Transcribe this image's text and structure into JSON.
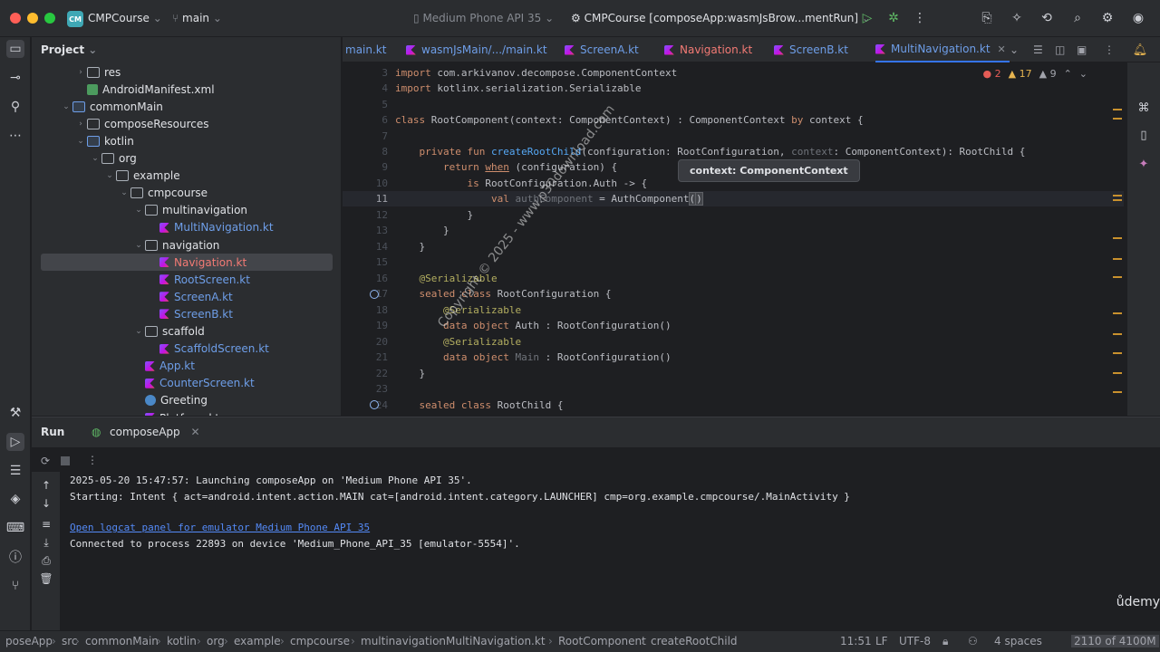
{
  "titlebar": {
    "project_badge": "CM",
    "project_name": "CMPCourse",
    "branch": "main",
    "device": "Medium Phone API 35",
    "run_config": "CMPCourse [composeApp:wasmJsBrow...mentRun]"
  },
  "project_panel": {
    "title": "Project",
    "tree": [
      {
        "label": "res",
        "depth": 4,
        "kind": "folder",
        "expanded": false
      },
      {
        "label": "AndroidManifest.xml",
        "depth": 4,
        "kind": "xml"
      },
      {
        "label": "commonMain",
        "depth": 3,
        "kind": "folder-blue",
        "expanded": true
      },
      {
        "label": "composeResources",
        "depth": 4,
        "kind": "folder",
        "expanded": false
      },
      {
        "label": "kotlin",
        "depth": 4,
        "kind": "folder-blue",
        "expanded": true
      },
      {
        "label": "org",
        "depth": 5,
        "kind": "folder",
        "expanded": true
      },
      {
        "label": "example",
        "depth": 6,
        "kind": "folder",
        "expanded": true
      },
      {
        "label": "cmpcourse",
        "depth": 7,
        "kind": "folder",
        "expanded": true
      },
      {
        "label": "multinavigation",
        "depth": 8,
        "kind": "folder",
        "expanded": true
      },
      {
        "label": "MultiNavigation.kt",
        "depth": 9,
        "kind": "kt",
        "color": "blue"
      },
      {
        "label": "navigation",
        "depth": 8,
        "kind": "folder",
        "expanded": true
      },
      {
        "label": "Navigation.kt",
        "depth": 9,
        "kind": "kt",
        "color": "red",
        "selected": true
      },
      {
        "label": "RootScreen.kt",
        "depth": 9,
        "kind": "kt",
        "color": "blue"
      },
      {
        "label": "ScreenA.kt",
        "depth": 9,
        "kind": "kt",
        "color": "blue"
      },
      {
        "label": "ScreenB.kt",
        "depth": 9,
        "kind": "kt",
        "color": "blue"
      },
      {
        "label": "scaffold",
        "depth": 8,
        "kind": "folder",
        "expanded": true
      },
      {
        "label": "ScaffoldScreen.kt",
        "depth": 9,
        "kind": "kt",
        "color": "blue"
      },
      {
        "label": "App.kt",
        "depth": 8,
        "kind": "kt",
        "color": "blue"
      },
      {
        "label": "CounterScreen.kt",
        "depth": 8,
        "kind": "kt",
        "color": "blue"
      },
      {
        "label": "Greeting",
        "depth": 8,
        "kind": "greeting"
      },
      {
        "label": "Platform.kt",
        "depth": 8,
        "kind": "kt"
      }
    ]
  },
  "tabs": [
    {
      "label": "main.kt"
    },
    {
      "label": "wasmJsMain/.../main.kt"
    },
    {
      "label": "ScreenA.kt"
    },
    {
      "label": "Navigation.kt"
    },
    {
      "label": "ScreenB.kt"
    },
    {
      "label": "MultiNavigation.kt",
      "active": true
    }
  ],
  "inspections": {
    "errors": "2",
    "warnings": "17",
    "weak": "9"
  },
  "editor": {
    "line_numbers": [
      "3",
      "4",
      "5",
      "6",
      "7",
      "8",
      "9",
      "10",
      "11",
      "12",
      "13",
      "14",
      "15",
      "16",
      "17",
      "18",
      "19",
      "20",
      "21",
      "22",
      "23",
      "24"
    ],
    "current_line": "11",
    "tooltip": "context: ComponentContext"
  },
  "watermark": "Copyright © 2025 - www.p30download.com",
  "run_panel": {
    "tab_title": "Run",
    "config_tab": "composeApp",
    "lines": [
      "2025-05-20 15:47:57: Launching composeApp on 'Medium Phone API 35'.",
      "Starting: Intent { act=android.intent.action.MAIN cat=[android.intent.category.LAUNCHER] cmp=org.example.cmpcourse/.MainActivity }",
      "",
      "Open logcat panel for emulator Medium Phone API 35",
      "Connected to process 22893 on device 'Medium_Phone_API_35 [emulator-5554]'."
    ],
    "brand": "ůdemy"
  },
  "statusbar": {
    "breadcrumb": [
      "poseApp",
      "src",
      "commonMain",
      "kotlin",
      "org",
      "example",
      "cmpcourse",
      "multinavigation",
      "MultiNavigation.kt",
      "RootComponent",
      "createRootChild"
    ],
    "position": "11:51",
    "line_sep": "LF",
    "encoding": "UTF-8",
    "indent": "4 spaces",
    "memory": "2110 of 4100M"
  }
}
